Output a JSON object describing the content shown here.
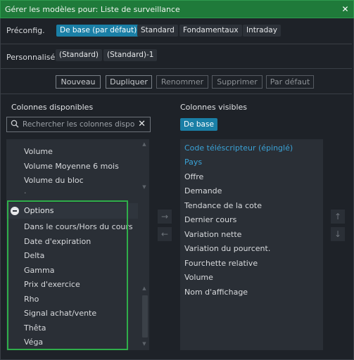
{
  "window": {
    "title": "Gérer les modèles pour: Liste de surveillance",
    "close_glyph": "✕"
  },
  "preconfig": {
    "label": "Préconfig.",
    "chips": [
      {
        "label": "De base (par défaut)",
        "active": true
      },
      {
        "label": "Standard",
        "active": false
      },
      {
        "label": "Fondamentaux",
        "active": false
      },
      {
        "label": "Intraday",
        "active": false
      }
    ]
  },
  "custom": {
    "label": "Personnalisé",
    "chips": [
      {
        "label": "(Standard)"
      },
      {
        "label": "(Standard)-1"
      }
    ]
  },
  "actions": {
    "new": "Nouveau",
    "duplicate": "Dupliquer",
    "rename": "Renommer",
    "delete": "Supprimer",
    "default": "Par défaut"
  },
  "available": {
    "title": "Colonnes disponibles",
    "search_placeholder": "Rechercher les colonnes disponibles",
    "clear_glyph": "✕",
    "items_above": [
      "Volume",
      "Volume Moyenne 6 mois",
      "Volume du bloc"
    ],
    "group": "Options",
    "group_items": [
      "Dans le cours/Hors du cours",
      "Date d'expiration",
      "Delta",
      "Gamma",
      "Prix d'exercice",
      "Rho",
      "Signal achat/vente",
      "Thêta",
      "Véga"
    ]
  },
  "transfer": {
    "add_glyph": "→",
    "remove_glyph": "←"
  },
  "visible": {
    "title": "Colonnes visibles",
    "tag": "De base",
    "items": [
      {
        "label": "Code téléscripteur (épinglé)",
        "pinned": true
      },
      {
        "label": "Pays",
        "pinned": true
      },
      {
        "label": "Offre",
        "pinned": false
      },
      {
        "label": "Demande",
        "pinned": false
      },
      {
        "label": "Tendance de la cote",
        "pinned": false
      },
      {
        "label": "Dernier cours",
        "pinned": false
      },
      {
        "label": "Variation nette",
        "pinned": false
      },
      {
        "label": "Variation du pourcent.",
        "pinned": false
      },
      {
        "label": "Fourchette relative",
        "pinned": false
      },
      {
        "label": "Volume",
        "pinned": false
      },
      {
        "label": "Nom d'affichage",
        "pinned": false
      }
    ]
  },
  "reorder": {
    "up_glyph": "↑",
    "down_glyph": "↓"
  },
  "colors": {
    "title_bar": "#1f7a3a",
    "accent": "#1a7fa6",
    "pinned_text": "#3aa2d6",
    "highlight_box": "#2fae4a"
  },
  "icons": [
    "search-icon",
    "clear-icon",
    "collapse-group-icon",
    "arrow-right-icon",
    "arrow-left-icon",
    "arrow-up-icon",
    "arrow-down-icon",
    "close-icon"
  ]
}
